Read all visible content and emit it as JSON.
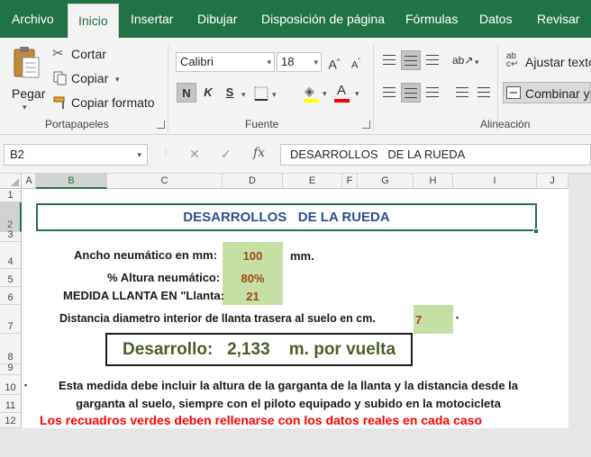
{
  "ribbon": {
    "tabs": [
      "Archivo",
      "Inicio",
      "Insertar",
      "Dibujar",
      "Disposición de página",
      "Fórmulas",
      "Datos",
      "Revisar"
    ],
    "clipboard": {
      "paste": "Pegar",
      "cut": "Cortar",
      "copy": "Copiar",
      "format_painter": "Copiar formato",
      "group": "Portapapeles"
    },
    "font": {
      "name": "Calibri",
      "size": "18",
      "grow": "A",
      "shrink": "A",
      "bold": "N",
      "italic": "K",
      "underline": "S",
      "font_color": "A",
      "group": "Fuente"
    },
    "alignment": {
      "wrap_text": "Ajustar texto",
      "merge": "Combinar y",
      "group": "Alineación"
    }
  },
  "formula_bar": {
    "name_box": "B2",
    "fx": "fx",
    "content": "DESARROLLOS   DE LA RUEDA"
  },
  "grid": {
    "columns": [
      "A",
      "B",
      "C",
      "D",
      "E",
      "F",
      "G",
      "H",
      "I",
      "J"
    ],
    "rows": [
      "1",
      "2",
      "3",
      "4",
      "5",
      "6",
      "7",
      "8",
      "9",
      "10",
      "11",
      "12"
    ],
    "selected_column": "B",
    "selected_row": "2"
  },
  "sheet": {
    "title": "DESARROLLOS   DE LA RUEDA",
    "tire_width_label": "Ancho neumático en mm:",
    "tire_width_value": "100",
    "tire_width_unit": "mm.",
    "tire_height_label": "% Altura neumático:",
    "tire_height_value": "80%",
    "rim_label": "MEDIDA LLANTA EN \"Llanta:",
    "rim_value": "21",
    "distance_label": "Distancia diametro interior de  llanta trasera al suelo en cm.",
    "distance_value": "7",
    "development": "Desarrollo:   2,133    m. por vuelta",
    "note_line1": "Esta medida debe incluir la altura de la garganta de la llanta y la distancia desde la",
    "note_line2": "garganta al suelo, siempre con el piloto equipado y subido en la motocicleta",
    "warning": "Los  recuadros verdes deben rellenarse con los datos reales en cada caso"
  },
  "colors": {
    "excel_green": "#217346",
    "input_fill": "#c6dfa5",
    "title_text": "#2e4f8f",
    "value_text": "#9a4a12",
    "development_text": "#4b5f28",
    "warning_text": "#ff0000"
  }
}
